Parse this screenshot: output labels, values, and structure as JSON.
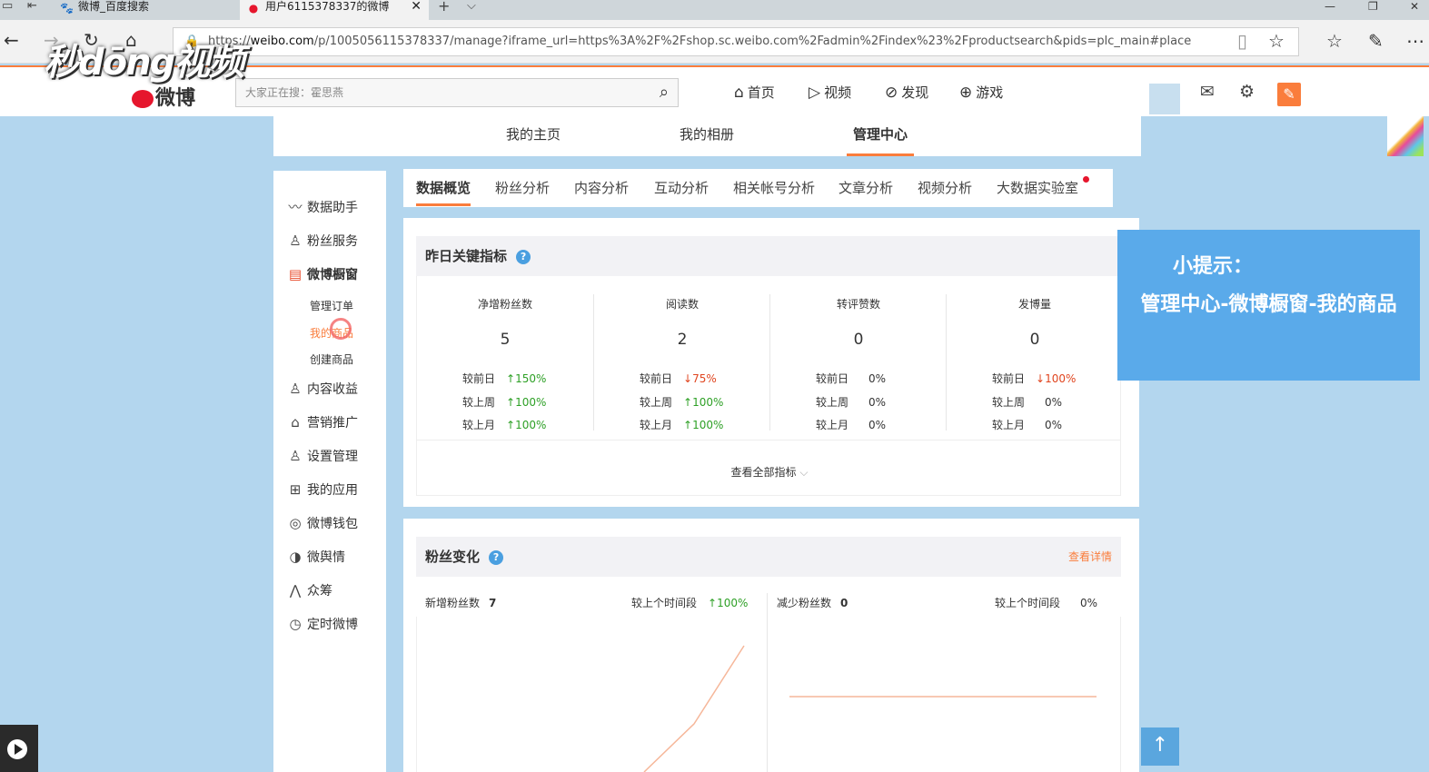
{
  "browser": {
    "tabs": [
      {
        "label": "微博_百度搜索",
        "icon": "paw-icon"
      },
      {
        "label": "用户6115378337的微博",
        "icon": "weibo-icon",
        "active": true
      }
    ],
    "close_symbol": "✕",
    "new_tab_symbol": "+",
    "tab_list_symbol": "⌵",
    "url_prefix": "https://",
    "url_host": "weibo.com",
    "url_rest": "/p/1005056115378337/manage?iframe_url=https%3A%2F%2Fshop.sc.weibo.com%2Fadmin%2Findex%23%2Fproductsearch&pids=plc_main#place",
    "window_controls": [
      "—",
      "❐",
      "✕"
    ]
  },
  "watermark": "秒dōng视频",
  "header": {
    "logo_text": "微博",
    "search_placeholder": "大家正在搜：霍思燕",
    "nav": [
      {
        "label": "首页",
        "icon": "home-icon"
      },
      {
        "label": "视频",
        "icon": "video-icon"
      },
      {
        "label": "发现",
        "icon": "compass-icon"
      },
      {
        "label": "游戏",
        "icon": "gamepad-icon"
      }
    ]
  },
  "profile_tabs": [
    {
      "label": "我的主页"
    },
    {
      "label": "我的相册"
    },
    {
      "label": "管理中心",
      "active": true
    }
  ],
  "sidebar": {
    "items": [
      {
        "label": "数据助手",
        "icon": "chart-line-icon"
      },
      {
        "label": "粉丝服务",
        "icon": "fans-icon"
      },
      {
        "label": "微博橱窗",
        "icon": "shop-icon",
        "active": true
      },
      {
        "label": "内容收益",
        "icon": "user-income-icon"
      },
      {
        "label": "营销推广",
        "icon": "bag-icon"
      },
      {
        "label": "设置管理",
        "icon": "user-settings-icon"
      },
      {
        "label": "我的应用",
        "icon": "apps-grid-icon"
      },
      {
        "label": "微博钱包",
        "icon": "wallet-icon"
      },
      {
        "label": "微舆情",
        "icon": "opinion-icon"
      },
      {
        "label": "众筹",
        "icon": "crowdfund-icon"
      },
      {
        "label": "定时微博",
        "icon": "timer-icon"
      }
    ],
    "sub_items": [
      {
        "label": "管理订单"
      },
      {
        "label": "我的商品",
        "active": true
      },
      {
        "label": "创建商品"
      }
    ]
  },
  "analysis_tabs": [
    {
      "label": "数据概览",
      "active": true
    },
    {
      "label": "粉丝分析"
    },
    {
      "label": "内容分析"
    },
    {
      "label": "互动分析"
    },
    {
      "label": "相关帐号分析"
    },
    {
      "label": "文章分析"
    },
    {
      "label": "视频分析"
    },
    {
      "label": "大数据实验室",
      "badge": true
    }
  ],
  "key_metrics": {
    "title": "昨日关键指标",
    "help_symbol": "?",
    "columns": [
      {
        "label": "净增粉丝数",
        "value": "5",
        "rows": [
          {
            "label": "较前日",
            "dir": "up",
            "change": "150%"
          },
          {
            "label": "较上周",
            "dir": "up",
            "change": "100%"
          },
          {
            "label": "较上月",
            "dir": "up",
            "change": "100%"
          }
        ]
      },
      {
        "label": "阅读数",
        "value": "2",
        "rows": [
          {
            "label": "较前日",
            "dir": "down",
            "change": "75%"
          },
          {
            "label": "较上周",
            "dir": "up",
            "change": "100%"
          },
          {
            "label": "较上月",
            "dir": "up",
            "change": "100%"
          }
        ]
      },
      {
        "label": "转评赞数",
        "value": "0",
        "rows": [
          {
            "label": "较前日",
            "dir": "none",
            "change": "0%"
          },
          {
            "label": "较上周",
            "dir": "none",
            "change": "0%"
          },
          {
            "label": "较上月",
            "dir": "none",
            "change": "0%"
          }
        ]
      },
      {
        "label": "发博量",
        "value": "0",
        "rows": [
          {
            "label": "较前日",
            "dir": "down",
            "change": "100%"
          },
          {
            "label": "较上周",
            "dir": "none",
            "change": "0%"
          },
          {
            "label": "较上月",
            "dir": "none",
            "change": "0%"
          }
        ]
      }
    ],
    "view_all": "查看全部指标"
  },
  "tip": {
    "title": "小提示：",
    "body": "管理中心-微博橱窗-我的商品"
  },
  "fans_change": {
    "title": "粉丝变化",
    "detail_link": "查看详情",
    "new_fans_label": "新增粉丝数",
    "new_fans_value": "7",
    "new_compare_label": "较上个时间段",
    "new_compare_change": "100%",
    "lost_fans_label": "减少粉丝数",
    "lost_fans_value": "0",
    "lost_compare_label": "较上个时间段",
    "lost_compare_change": "0%"
  },
  "colors": {
    "accent": "#fa7d3c",
    "up": "#2ea026",
    "down": "#e0451f",
    "tip_bg": "#5aaaea",
    "page_bg": "#b3d6ee"
  }
}
